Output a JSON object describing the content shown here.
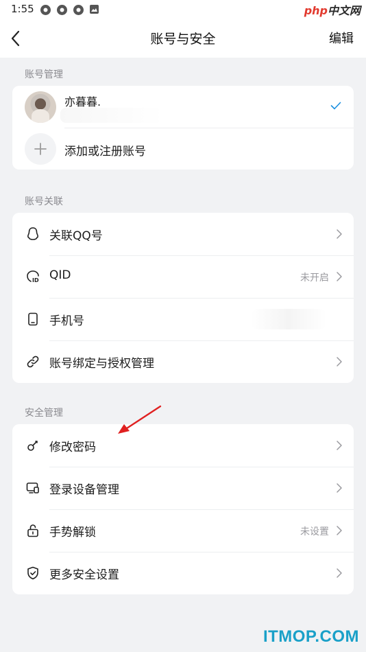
{
  "status_bar": {
    "time": "1:55",
    "watermark_php": "php",
    "watermark_cn": "中文网"
  },
  "nav": {
    "title": "账号与安全",
    "edit_label": "编辑"
  },
  "account_section": {
    "label": "账号管理",
    "current_account_name": "亦暮暮.",
    "add_label": "添加或注册账号"
  },
  "link_section": {
    "label": "账号关联",
    "items": [
      {
        "label": "关联QQ号",
        "value": "",
        "icon": "qq-icon"
      },
      {
        "label": "QID",
        "value": "未开启",
        "icon": "qid-icon"
      },
      {
        "label": "手机号",
        "value": "",
        "icon": "phone-icon"
      },
      {
        "label": "账号绑定与授权管理",
        "value": "",
        "icon": "link-icon"
      }
    ]
  },
  "security_section": {
    "label": "安全管理",
    "items": [
      {
        "label": "修改密码",
        "value": "",
        "icon": "key-icon"
      },
      {
        "label": "登录设备管理",
        "value": "",
        "icon": "device-icon"
      },
      {
        "label": "手势解锁",
        "value": "未设置",
        "icon": "lock-icon"
      },
      {
        "label": "更多安全设置",
        "value": "",
        "icon": "shield-icon"
      }
    ]
  },
  "colors": {
    "accent": "#1a8fe0",
    "background": "#f1f2f4",
    "annotation_arrow": "#e02020",
    "site_watermark": "#1aa0c8"
  },
  "site_watermark": "ITMOP.COM"
}
